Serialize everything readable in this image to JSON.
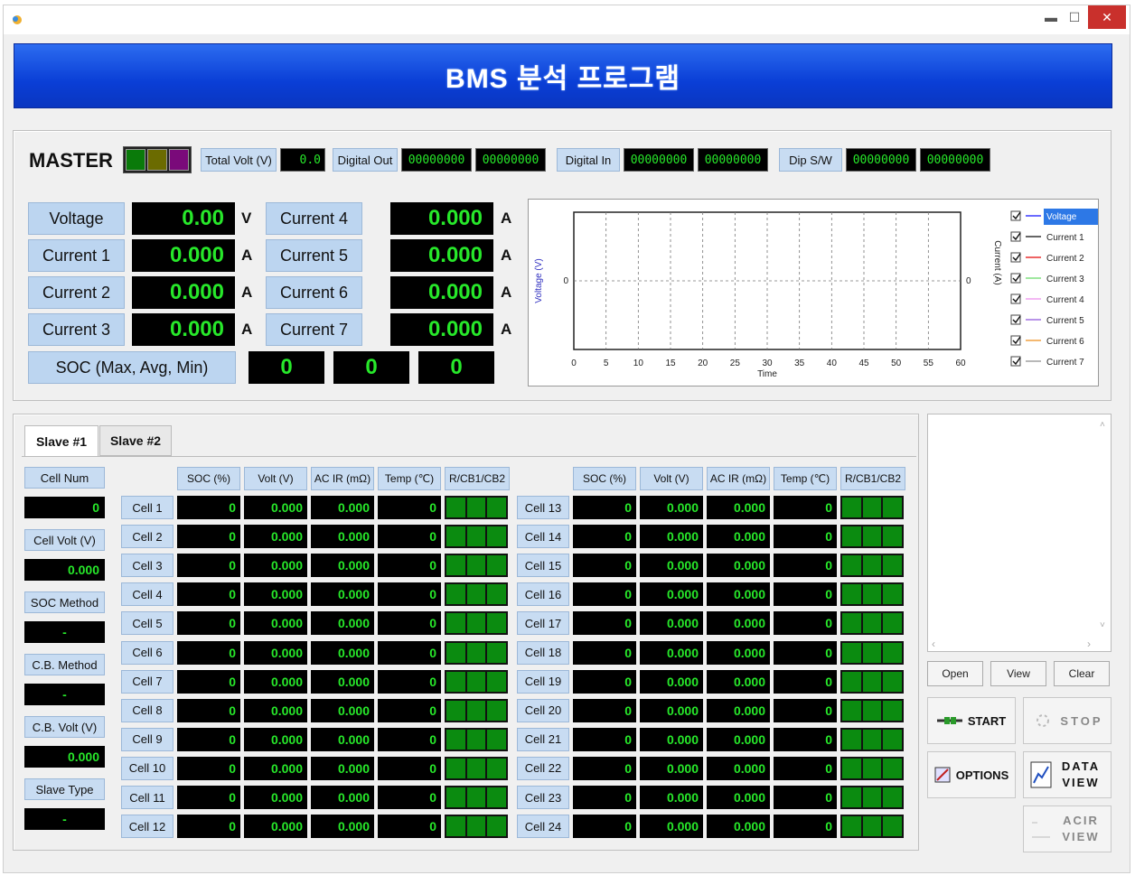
{
  "window": {
    "controls": {
      "minimize": "▬",
      "maximize": "☐",
      "close": "✕"
    }
  },
  "banner": {
    "title": "BMS 분석 프로그램"
  },
  "master": {
    "label": "MASTER",
    "led_colors": [
      "#0a7a0a",
      "#6b6b00",
      "#7a0a7a"
    ],
    "total_volt_label": "Total Volt (V)",
    "total_volt_value": "0.0",
    "digital_out_label": "Digital Out",
    "digital_out_values": [
      "00000000",
      "00000000"
    ],
    "digital_in_label": "Digital In",
    "digital_in_values": [
      "00000000",
      "00000000"
    ],
    "dip_sw_label": "Dip S/W",
    "dip_sw_values": [
      "00000000",
      "00000000"
    ],
    "voltage_label": "Voltage",
    "voltage_value": "0.00",
    "voltage_unit": "V",
    "current1_label": "Current 1",
    "current1_value": "0.000",
    "current1_unit": "A",
    "current2_label": "Current 2",
    "current2_value": "0.000",
    "current2_unit": "A",
    "current3_label": "Current 3",
    "current3_value": "0.000",
    "current3_unit": "A",
    "current4_label": "Current 4",
    "current4_value": "0.000",
    "current4_unit": "A",
    "current5_label": "Current 5",
    "current5_value": "0.000",
    "current5_unit": "A",
    "current6_label": "Current 6",
    "current6_value": "0.000",
    "current6_unit": "A",
    "current7_label": "Current 7",
    "current7_value": "0.000",
    "current7_unit": "A",
    "soc_label": "SOC (Max, Avg, Min)",
    "soc_values": [
      "0",
      "0",
      "0"
    ]
  },
  "chart_data": {
    "type": "line",
    "xlabel": "Time",
    "ylabel": "Voltage (V)",
    "y2label": "Current (A)",
    "xlim": [
      0,
      60
    ],
    "x_ticks": [
      "0",
      "5",
      "10",
      "15",
      "20",
      "25",
      "30",
      "35",
      "40",
      "45",
      "50",
      "55",
      "60"
    ],
    "y_tick": "0",
    "y2_tick": "0",
    "grid": true,
    "legend_position": "right",
    "series": [
      {
        "name": "Voltage",
        "color": "#3a3aff",
        "values": [],
        "checked": true
      },
      {
        "name": "Current 1",
        "color": "#333333",
        "values": [],
        "checked": true
      },
      {
        "name": "Current 2",
        "color": "#e83030",
        "values": [],
        "checked": true
      },
      {
        "name": "Current 3",
        "color": "#80e080",
        "values": [],
        "checked": true
      },
      {
        "name": "Current 4",
        "color": "#f0a0f0",
        "values": [],
        "checked": true
      },
      {
        "name": "Current 5",
        "color": "#a070e0",
        "values": [],
        "checked": true
      },
      {
        "name": "Current 6",
        "color": "#f0a040",
        "values": [],
        "checked": true
      },
      {
        "name": "Current 7",
        "color": "#a0a0a0",
        "values": [],
        "checked": true
      }
    ]
  },
  "slave": {
    "tabs": [
      "Slave #1",
      "Slave #2"
    ],
    "side": {
      "cell_num_label": "Cell Num",
      "cell_num_value": "0",
      "cell_volt_label": "Cell Volt (V)",
      "cell_volt_value": "0.000",
      "soc_method_label": "SOC Method",
      "soc_method_value": "-",
      "cb_method_label": "C.B. Method",
      "cb_method_value": "-",
      "cb_volt_label": "C.B. Volt (V)",
      "cb_volt_value": "0.000",
      "slave_type_label": "Slave Type",
      "slave_type_value": "-"
    },
    "columns": [
      "SOC (%)",
      "Volt (V)",
      "AC IR (mΩ)",
      "Temp (℃)",
      "R/CB1/CB2"
    ],
    "cells": [
      {
        "name": "Cell 1",
        "soc": "0",
        "volt": "0.000",
        "acir": "0.000",
        "temp": "0"
      },
      {
        "name": "Cell 2",
        "soc": "0",
        "volt": "0.000",
        "acir": "0.000",
        "temp": "0"
      },
      {
        "name": "Cell 3",
        "soc": "0",
        "volt": "0.000",
        "acir": "0.000",
        "temp": "0"
      },
      {
        "name": "Cell 4",
        "soc": "0",
        "volt": "0.000",
        "acir": "0.000",
        "temp": "0"
      },
      {
        "name": "Cell 5",
        "soc": "0",
        "volt": "0.000",
        "acir": "0.000",
        "temp": "0"
      },
      {
        "name": "Cell 6",
        "soc": "0",
        "volt": "0.000",
        "acir": "0.000",
        "temp": "0"
      },
      {
        "name": "Cell 7",
        "soc": "0",
        "volt": "0.000",
        "acir": "0.000",
        "temp": "0"
      },
      {
        "name": "Cell 8",
        "soc": "0",
        "volt": "0.000",
        "acir": "0.000",
        "temp": "0"
      },
      {
        "name": "Cell 9",
        "soc": "0",
        "volt": "0.000",
        "acir": "0.000",
        "temp": "0"
      },
      {
        "name": "Cell 10",
        "soc": "0",
        "volt": "0.000",
        "acir": "0.000",
        "temp": "0"
      },
      {
        "name": "Cell 11",
        "soc": "0",
        "volt": "0.000",
        "acir": "0.000",
        "temp": "0"
      },
      {
        "name": "Cell 12",
        "soc": "0",
        "volt": "0.000",
        "acir": "0.000",
        "temp": "0"
      },
      {
        "name": "Cell 13",
        "soc": "0",
        "volt": "0.000",
        "acir": "0.000",
        "temp": "0"
      },
      {
        "name": "Cell 14",
        "soc": "0",
        "volt": "0.000",
        "acir": "0.000",
        "temp": "0"
      },
      {
        "name": "Cell 15",
        "soc": "0",
        "volt": "0.000",
        "acir": "0.000",
        "temp": "0"
      },
      {
        "name": "Cell 16",
        "soc": "0",
        "volt": "0.000",
        "acir": "0.000",
        "temp": "0"
      },
      {
        "name": "Cell 17",
        "soc": "0",
        "volt": "0.000",
        "acir": "0.000",
        "temp": "0"
      },
      {
        "name": "Cell 18",
        "soc": "0",
        "volt": "0.000",
        "acir": "0.000",
        "temp": "0"
      },
      {
        "name": "Cell 19",
        "soc": "0",
        "volt": "0.000",
        "acir": "0.000",
        "temp": "0"
      },
      {
        "name": "Cell 20",
        "soc": "0",
        "volt": "0.000",
        "acir": "0.000",
        "temp": "0"
      },
      {
        "name": "Cell 21",
        "soc": "0",
        "volt": "0.000",
        "acir": "0.000",
        "temp": "0"
      },
      {
        "name": "Cell 22",
        "soc": "0",
        "volt": "0.000",
        "acir": "0.000",
        "temp": "0"
      },
      {
        "name": "Cell 23",
        "soc": "0",
        "volt": "0.000",
        "acir": "0.000",
        "temp": "0"
      },
      {
        "name": "Cell 24",
        "soc": "0",
        "volt": "0.000",
        "acir": "0.000",
        "temp": "0"
      }
    ]
  },
  "controls": {
    "open_label": "Open",
    "view_label": "View",
    "clear_label": "Clear",
    "start_label": "START",
    "stop_label": "STOP",
    "options_label": "OPTIONS",
    "data_view_label": "DATA VIEW",
    "acir_view_label": "ACIR VIEW"
  }
}
